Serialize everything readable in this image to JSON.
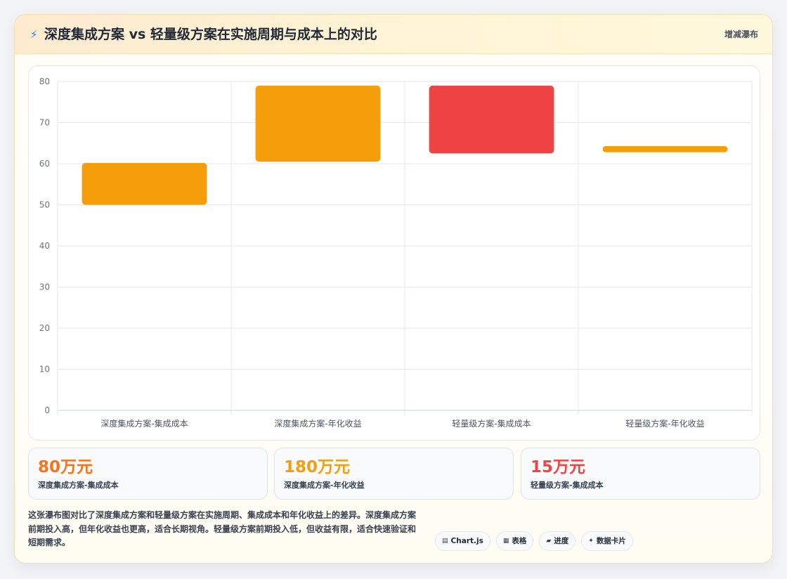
{
  "header": {
    "icon": "⚡",
    "title": "深度集成方案 vs 轻量级方案在实施周期与成本上的对比",
    "tag": "增减瀑布"
  },
  "colors": {
    "increase": "#f59e0b",
    "decrease": "#ef4444",
    "grid": "#e5e7eb",
    "tick": "#6b7280",
    "stat1": "#f97316",
    "stat2": "#f59e0b",
    "stat3": "#ef4444"
  },
  "chart_data": {
    "type": "bar",
    "subtype": "waterfall",
    "categories": [
      "深度集成方案-集成成本",
      "深度集成方案-年化收益",
      "轻量级方案-集成成本",
      "轻量级方案-年化收益"
    ],
    "ranges": [
      [
        50,
        60.2
      ],
      [
        60.5,
        79
      ],
      [
        62.5,
        79
      ],
      [
        62.8,
        64.3
      ]
    ],
    "directions": [
      "increase",
      "increase",
      "decrease",
      "increase"
    ],
    "ylim": [
      0,
      80
    ],
    "yticks": [
      0,
      10,
      20,
      30,
      40,
      50,
      60,
      70,
      80
    ],
    "grid": true,
    "legend": "none"
  },
  "stats": [
    {
      "value": "80万元",
      "label": "深度集成方案-集成成本"
    },
    {
      "value": "180万元",
      "label": "深度集成方案-年化收益"
    },
    {
      "value": "15万元",
      "label": "轻量级方案-集成成本"
    }
  ],
  "description": "这张瀑布图对比了深度集成方案和轻量级方案在实施周期、集成成本和年化收益上的差异。深度集成方案前期投入高，但年化收益也更高，适合长期视角。轻量级方案前期投入低，但收益有限，适合快速验证和短期需求。",
  "tags": [
    {
      "icon": "▤",
      "label": "Chart.js"
    },
    {
      "icon": "▦",
      "label": "表格"
    },
    {
      "icon": "▰",
      "label": "进度"
    },
    {
      "icon": "✦",
      "label": "数据卡片"
    }
  ]
}
